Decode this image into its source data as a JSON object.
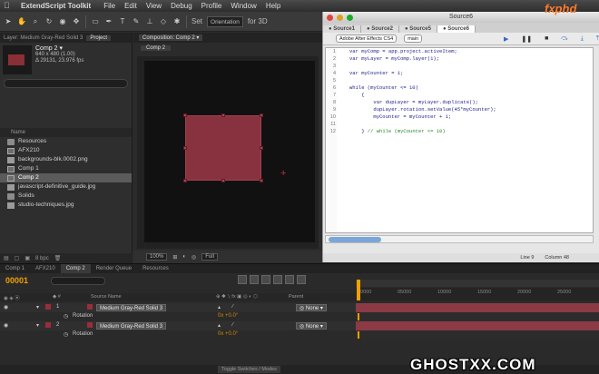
{
  "menubar": {
    "app": "ExtendScript Toolkit",
    "items": [
      "File",
      "Edit",
      "View",
      "Debug",
      "Profile",
      "Window",
      "Help"
    ]
  },
  "ae_toolbar": {
    "set_label": "Set",
    "orientation": "Orientation",
    "for_label": "for 3D"
  },
  "project": {
    "tabs": [
      "Layer: Medium Gray-Red Solid 3",
      "Project"
    ],
    "selected_name": "Comp 2 ▾",
    "selected_info1": "640 x 480 (1.00)",
    "selected_info2": "Δ 29131, 23.976 fps",
    "header_name": "Name",
    "items": [
      {
        "label": "Resources",
        "type": "folder"
      },
      {
        "label": "AFX210",
        "type": "comp"
      },
      {
        "label": "backgrounds-blk.0002.png",
        "type": "file"
      },
      {
        "label": "Comp 1",
        "type": "comp"
      },
      {
        "label": "Comp 2",
        "type": "comp",
        "selected": true
      },
      {
        "label": "javascript-definitive_guide.jpg",
        "type": "file"
      },
      {
        "label": "Solids",
        "type": "folder"
      },
      {
        "label": "studio-techniques.jpg",
        "type": "file"
      }
    ],
    "footer_bpc": "8 bpc"
  },
  "composition": {
    "panel_tab": "Composition: Comp 2 ▾",
    "sub_tab": "Comp 2",
    "zoom": "100%",
    "resolution": "Full"
  },
  "estk": {
    "title": "Source6",
    "tabs": [
      "Source1",
      "Source2",
      "Source5",
      "Source6"
    ],
    "active_tab": "Source6",
    "target_app": "Adobe After Effects CS4",
    "engine": "main",
    "code_lines": [
      {
        "n": "1",
        "text": "var myComp = app.project.activeItem;"
      },
      {
        "n": "2",
        "text": "var myLayer = myComp.layer(1);"
      },
      {
        "n": "3",
        "text": ""
      },
      {
        "n": "4",
        "text": "var myCounter = 1;"
      },
      {
        "n": "5",
        "text": ""
      },
      {
        "n": "6",
        "text": "while (myCounter <= 10)"
      },
      {
        "n": "7",
        "text": "    {"
      },
      {
        "n": "8",
        "text": "        var dupLayer = myLayer.duplicate();"
      },
      {
        "n": "9",
        "text": "        dupLayer.rotation.setValue(45*myCounter);"
      },
      {
        "n": "10",
        "text": "        myCounter = myCounter + 1;"
      },
      {
        "n": "11",
        "text": ""
      },
      {
        "n": "12",
        "text": "    } // while (myCounter <= 10)"
      }
    ],
    "status_line": "Line 9",
    "status_col": "Column 48"
  },
  "timeline": {
    "tabs": [
      "Comp 1",
      "AFX210",
      "Comp 2",
      "Render Queue",
      "Resources"
    ],
    "active_tab": "Comp 2",
    "timecode": "00001",
    "col_source": "Source Name",
    "col_parent": "Parent",
    "ruler": [
      "00000",
      "05000",
      "10000",
      "15000",
      "20000",
      "25000"
    ],
    "layers": [
      {
        "num": "1",
        "name": "Medium Gray-Red Solid 3",
        "parent": "None",
        "prop": "Rotation",
        "value": "0x +0.0°"
      },
      {
        "num": "2",
        "name": "Medium Gray-Red Solid 3",
        "parent": "None",
        "prop": "Rotation",
        "value": "0x +0.0°"
      }
    ],
    "toggle_label": "Toggle Switches / Modes"
  },
  "watermarks": {
    "fxphd": "fxphd",
    "ghost": "GHOSTXX.COM"
  }
}
